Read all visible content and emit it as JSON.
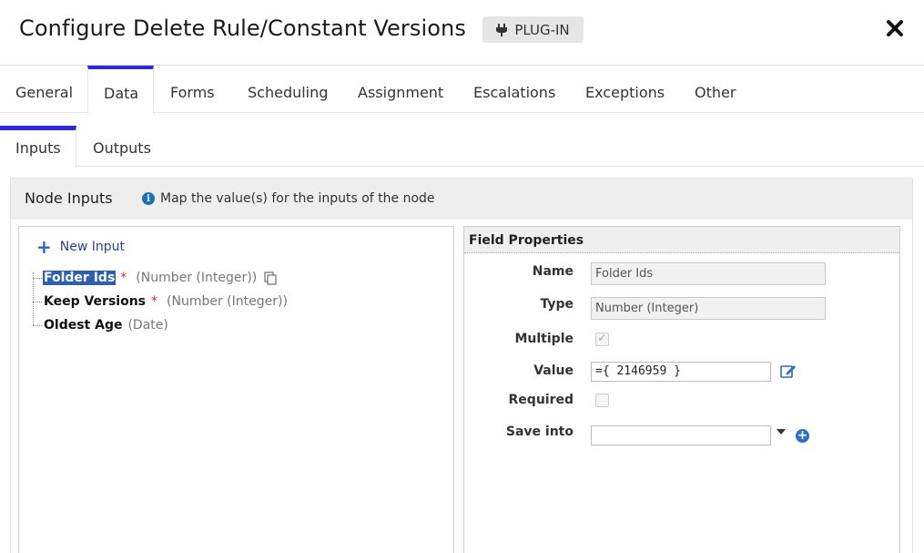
{
  "header": {
    "title": "Configure Delete Rule/Constant Versions",
    "badge": "PLUG-IN"
  },
  "tabs": [
    "General",
    "Data",
    "Forms",
    "Scheduling",
    "Assignment",
    "Escalations",
    "Exceptions",
    "Other"
  ],
  "active_tab": "Data",
  "subtabs": [
    "Inputs",
    "Outputs"
  ],
  "active_subtab": "Inputs",
  "node_inputs": {
    "title": "Node Inputs",
    "info": "Map the value(s) for the inputs of the node",
    "new_input_label": "New Input",
    "items": [
      {
        "name": "Folder Ids",
        "required": "*",
        "type": "(Number (Integer))",
        "selected": true
      },
      {
        "name": "Keep Versions",
        "required": "*",
        "type": "(Number (Integer))",
        "selected": false
      },
      {
        "name": "Oldest Age",
        "required": "",
        "type": "(Date)",
        "selected": false
      }
    ]
  },
  "field_properties": {
    "title": "Field Properties",
    "name_label": "Name",
    "name_value": "Folder Ids",
    "type_label": "Type",
    "type_value": "Number (Integer)",
    "multiple_label": "Multiple",
    "multiple_checked": true,
    "value_label": "Value",
    "value_value": "={ 2146959 }",
    "required_label": "Required",
    "required_checked": false,
    "save_into_label": "Save into",
    "save_into_value": ""
  },
  "colors": {
    "accent": "#2b2bd9",
    "selected_bg": "#2c5fb0",
    "required": "#c0392b",
    "link": "#2a3f9c"
  }
}
